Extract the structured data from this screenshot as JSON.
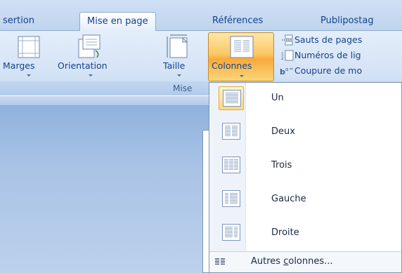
{
  "tabs": [
    {
      "label": "sertion"
    },
    {
      "label": "Mise en page",
      "active": true
    },
    {
      "label": "Références"
    },
    {
      "label": "Publipostag"
    }
  ],
  "ribbon": {
    "buttons": {
      "marges": "Marges",
      "orientation": "Orientation",
      "taille": "Taille",
      "colonnes": "Colonnes"
    },
    "small_commands": {
      "sauts": "Sauts de pages",
      "numeros": "Numéros de lig",
      "coupure": "Coupure de mo"
    },
    "group_label": "Mise"
  },
  "columns_menu": {
    "items": [
      {
        "label": "Un",
        "icon": "one-column-icon"
      },
      {
        "label": "Deux",
        "icon": "two-columns-icon"
      },
      {
        "label": "Trois",
        "icon": "three-columns-icon"
      },
      {
        "label": "Gauche",
        "icon": "left-column-icon"
      },
      {
        "label": "Droite",
        "icon": "right-column-icon"
      }
    ],
    "more": {
      "prefix": "Autres ",
      "underlined": "c",
      "suffix": "olonnes..."
    }
  },
  "colors": {
    "tab_text": "#15428b",
    "selected_button": "#fbc763",
    "hover_border": "#e3a93d"
  }
}
